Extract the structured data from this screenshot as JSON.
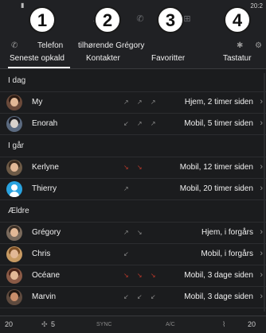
{
  "status": {
    "time": "20:2"
  },
  "tabs": {
    "phone": {
      "caption": "Telefon",
      "label": "Seneste opkald",
      "icon": "phone-icon"
    },
    "contacts": {
      "caption": "tilhørende Grégory",
      "label": "Kontakter"
    },
    "favorites": {
      "label": "Favoritter"
    },
    "keypad": {
      "label": "Tastatur"
    }
  },
  "callouts": [
    "1",
    "2",
    "3",
    "4"
  ],
  "sections": {
    "today": "I dag",
    "yesterday": "I går",
    "older": "Ældre"
  },
  "calls": {
    "today": [
      {
        "name": "My",
        "detail": "Hjem, 2 timer siden",
        "arrows": "↗ ↗ ↗",
        "arrow_color": "#8a8a8a"
      },
      {
        "name": "Enorah",
        "detail": "Mobil, 5 timer siden",
        "arrows": "↙ ↗ ↗",
        "arrow_color": "#8a8a8a"
      }
    ],
    "yesterday": [
      {
        "name": "Kerlyne",
        "detail": "Mobil, 12 timer siden",
        "arrows": "↘ ↘",
        "arrow_color": "#c0392b"
      },
      {
        "name": "Thierry",
        "detail": "Mobil, 20 timer siden",
        "arrows": "↗",
        "arrow_color": "#8a8a8a"
      }
    ],
    "older": [
      {
        "name": "Grégory",
        "detail": "Hjem, i forgårs",
        "arrows": "↗ ↘",
        "arrow_color": "#8a8a8a"
      },
      {
        "name": "Chris",
        "detail": "Mobil, i forgårs",
        "arrows": "↙",
        "arrow_color": "#8a8a8a"
      },
      {
        "name": "Océane",
        "detail": "Mobil, 3 dage siden",
        "arrows": "↘ ↘ ↘",
        "arrow_color": "#c0392b"
      },
      {
        "name": "Marvin",
        "detail": "Mobil, 3 dage siden",
        "arrows": "↙ ↙ ↙",
        "arrow_color": "#8a8a8a"
      }
    ]
  },
  "bottom": {
    "temp_left": "20",
    "fan": "5",
    "sync": "SYNC",
    "ac": "A/C",
    "temp_right": "20"
  },
  "colors": {
    "background": "#1b1c1e",
    "missed_call": "#c0392b",
    "callout_fill": "#ffffff"
  }
}
